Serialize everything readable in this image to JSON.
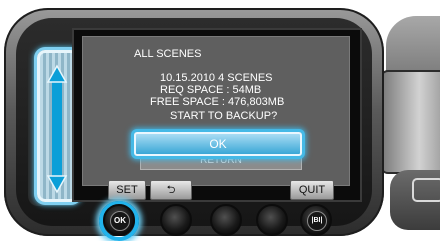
{
  "dialog": {
    "heading": "ALL SCENES",
    "lines": [
      "10.15.2010  4 SCENES",
      "REQ SPACE :       54MB",
      "FREE SPACE :  476,803MB",
      "START TO BACKUP?"
    ],
    "ok_label": "OK",
    "return_label": "RETURN"
  },
  "softkeys": {
    "set_label": "SET",
    "back_symbol": "⮌",
    "quit_label": "QUIT"
  },
  "keys": {
    "ok_key_label": "OK",
    "display_key_label": "|BI|"
  },
  "colors": {
    "highlight": "#22B3EC",
    "dialog_bg": "#5F5F5F"
  }
}
